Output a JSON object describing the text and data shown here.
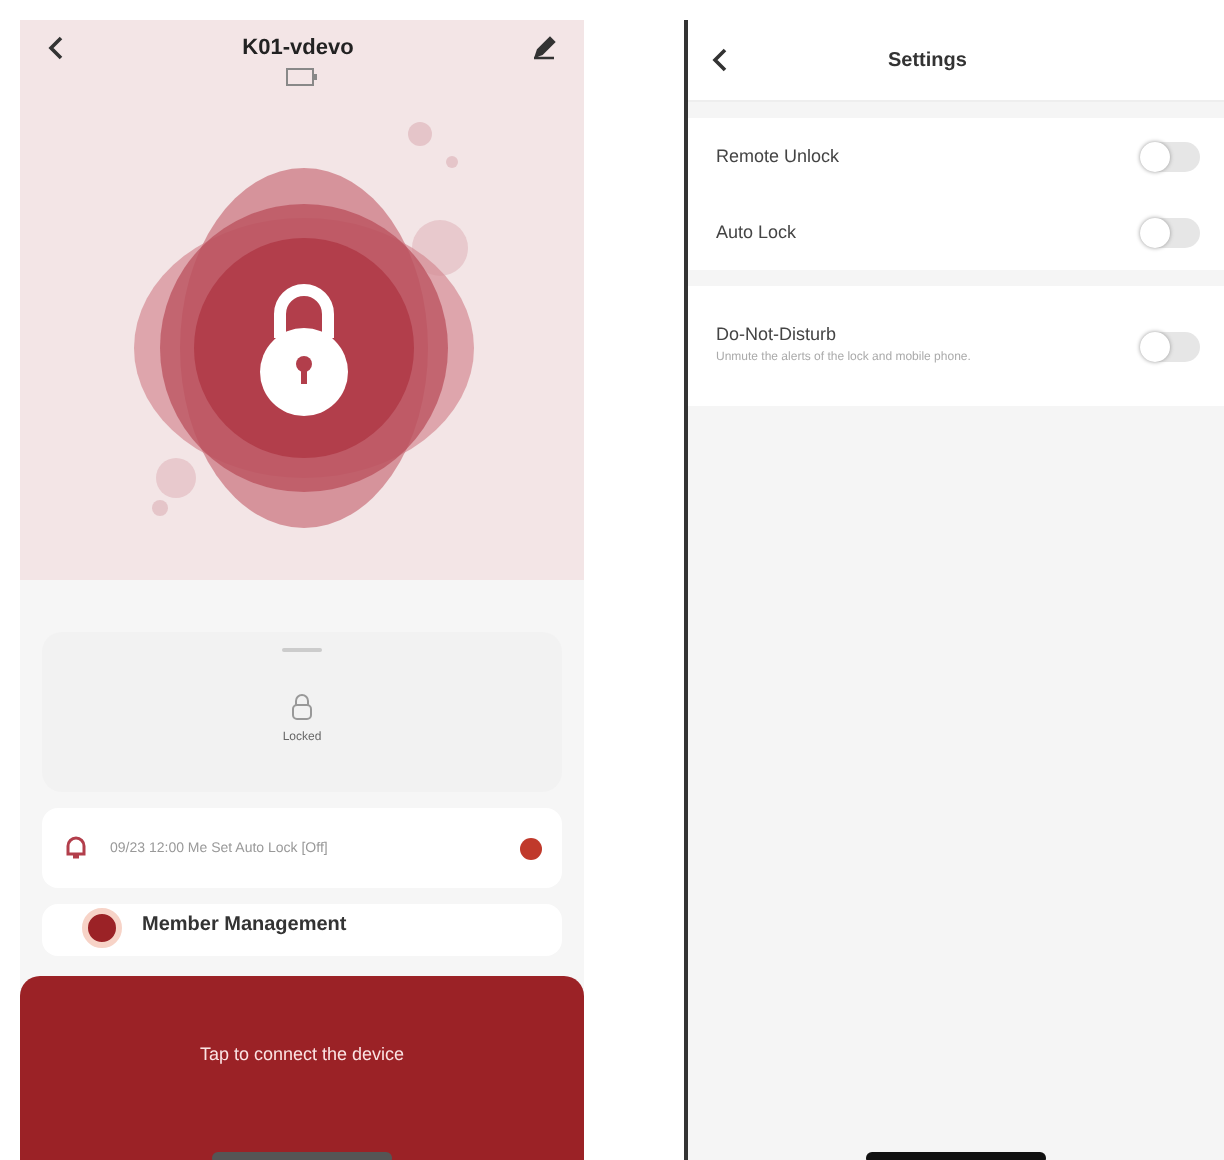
{
  "device_screen": {
    "title": "K01-vdevo",
    "status": "Locked",
    "notification": {
      "text": "09/23 12:00 Me Set Auto Lock [Off]",
      "unread": true
    },
    "menu": [
      {
        "label": "Member Management"
      }
    ],
    "connect_sheet": {
      "message": "Tap to connect the device"
    }
  },
  "settings_screen": {
    "title": "Settings",
    "items": [
      {
        "label": "Remote Unlock",
        "on": false
      },
      {
        "label": "Auto Lock",
        "on": false
      },
      {
        "label": "Do-Not-Disturb",
        "description": "Unmute the alerts of the lock and mobile phone.",
        "on": false
      }
    ]
  }
}
